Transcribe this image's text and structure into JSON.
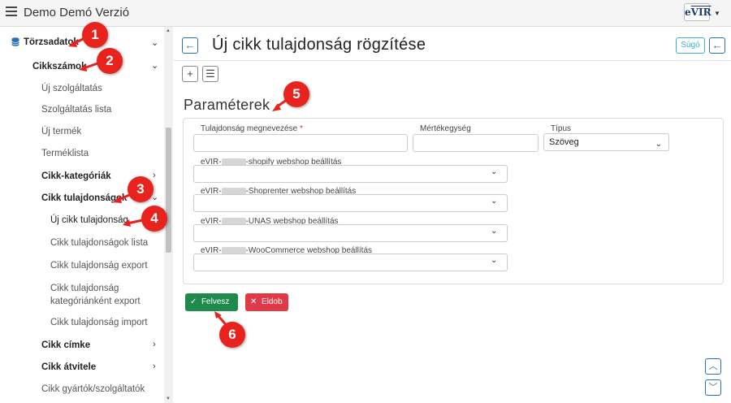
{
  "app": {
    "title": "Demo Demó Verzió",
    "logo_text": "eVIR"
  },
  "sidebar": {
    "items": [
      {
        "label": "Törzsadatok"
      },
      {
        "label": "Cikkszámok"
      },
      {
        "label": "Új szolgáltatás"
      },
      {
        "label": "Szolgáltatás lista"
      },
      {
        "label": "Új termék"
      },
      {
        "label": "Terméklista"
      },
      {
        "label": "Cikk-kategóriák"
      },
      {
        "label": "Cikk tulajdonságok"
      },
      {
        "label": "Új cikk tulajdonság"
      },
      {
        "label": "Cikk tulajdonságok lista"
      },
      {
        "label": "Cikk tulajdonság export"
      },
      {
        "label": "Cikk tulajdonság kategóriánként export"
      },
      {
        "label": "Cikk tulajdonság import"
      },
      {
        "label": "Cikk címke"
      },
      {
        "label": "Cikk átvitele"
      },
      {
        "label": "Cikk gyártók/szolgáltatók"
      }
    ]
  },
  "header": {
    "title": "Új cikk tulajdonság rögzítése",
    "help_label": "Súgó"
  },
  "section": {
    "title": "Paraméterek"
  },
  "form": {
    "name_label": "Tulajdonság megnevezése",
    "name_required": "*",
    "name_value": "",
    "unit_label": "Mértékegység",
    "unit_value": "",
    "type_label": "Típus",
    "type_value": "Szöveg",
    "webshops": [
      {
        "prefix": "eVIR-",
        "suffix": "-shopify webshop beállítás",
        "value": ""
      },
      {
        "prefix": "eVIR-",
        "suffix": "-Shoprenter webshop beállítás",
        "value": ""
      },
      {
        "prefix": "eVIR-",
        "suffix": "-UNAS webshop beállítás",
        "value": ""
      },
      {
        "prefix": "eVIR-",
        "suffix": "-WooCommerce webshop beállítás",
        "value": ""
      }
    ]
  },
  "actions": {
    "save_label": "Felvesz",
    "cancel_label": "Eldob"
  },
  "callouts": [
    "1",
    "2",
    "3",
    "4",
    "5",
    "6"
  ],
  "colors": {
    "primary": "#2a6fb5",
    "success": "#1e8a4c",
    "danger": "#e03a48",
    "callout": "#e8231e",
    "info": "#3bb0d0"
  }
}
